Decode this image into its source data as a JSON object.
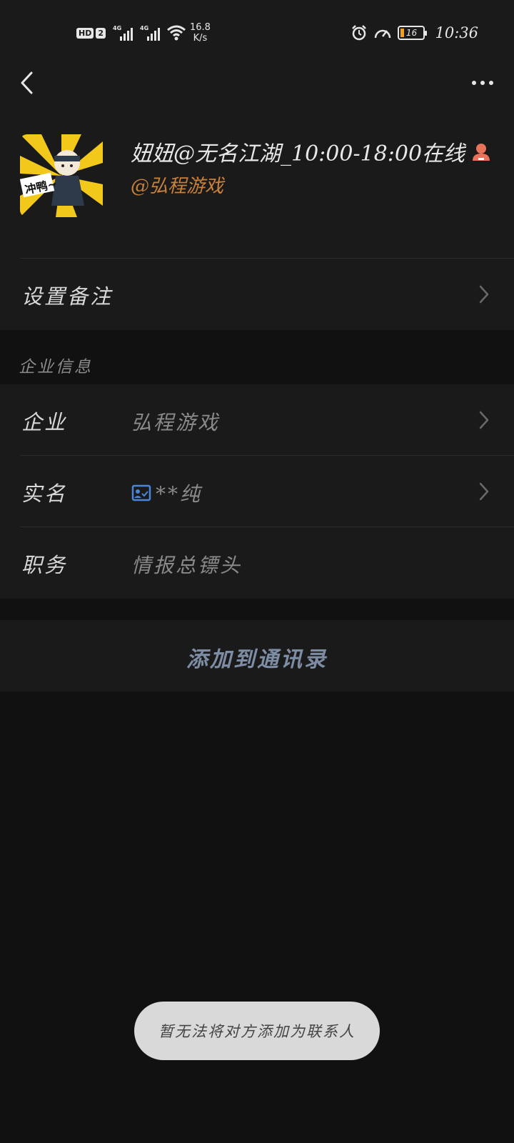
{
  "status_bar": {
    "hd_badge": "HD",
    "sim_number": "2",
    "network1": "4G",
    "network2": "4G",
    "speed_value": "16.8",
    "speed_unit": "K/s",
    "battery_level": "16",
    "time": "10:36",
    "icons": [
      "hd-icon",
      "signal-icon",
      "signal-icon",
      "wifi-icon",
      "alarm-icon",
      "speedometer-icon",
      "battery-icon"
    ]
  },
  "nav": {
    "back_icon": "chevron-left-icon",
    "more_icon": "more-dots-icon"
  },
  "profile": {
    "name": "妞妞@无名江湖_10:00-18:00在线",
    "corp_tag": "@弘程游戏",
    "avatar_text": "冲鸭~",
    "status_icon": "online-person-icon"
  },
  "remark_row": {
    "label": "设置备注"
  },
  "enterprise_section": {
    "header": "企业信息",
    "rows": [
      {
        "label": "企业",
        "value": "弘程游戏"
      },
      {
        "label": "实名",
        "value": "**纯"
      },
      {
        "label": "职务",
        "value": "情报总镖头"
      }
    ]
  },
  "add_button": "添加到通讯录",
  "toast": "暂无法将对方添加为联系人",
  "colors": {
    "background": "#111111",
    "surface": "#1a1a1a",
    "corp_tag": "#c9813a",
    "add_button": "#7d8da4",
    "verified_icon": "#4a86d8",
    "online_icon": "#e8735a",
    "battery_fill": "#f0a020"
  }
}
